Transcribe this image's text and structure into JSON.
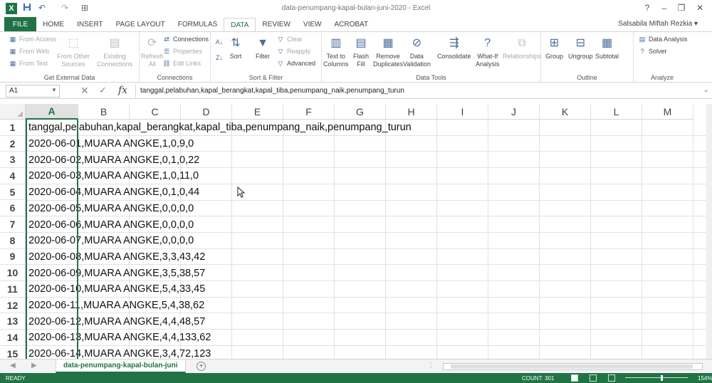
{
  "window": {
    "title": "data-penumpang-kapal-bulan-juni-2020 - Excel",
    "user": "Salsabila Miftah Rezkia",
    "help": "?",
    "minimize": "–",
    "maximize": "❐",
    "close": "✕"
  },
  "qat": {
    "logo": "X",
    "save": "💾",
    "undo": "↶",
    "redo": "↷",
    "customize": "⊞"
  },
  "tabs": [
    "FILE",
    "HOME",
    "INSERT",
    "PAGE LAYOUT",
    "FORMULAS",
    "DATA",
    "REVIEW",
    "VIEW",
    "ACROBAT"
  ],
  "active_tab": "DATA",
  "ribbon": {
    "get_external": {
      "label": "Get External Data",
      "from_access": "From Access",
      "from_web": "From Web",
      "from_text": "From Text",
      "from_other_1": "From Other",
      "from_other_2": "Sources",
      "existing_1": "Existing",
      "existing_2": "Connections"
    },
    "connections": {
      "label": "Connections",
      "refresh_1": "Refresh",
      "refresh_2": "All",
      "connections": "Connections",
      "properties": "Properties",
      "edit_links": "Edit Links"
    },
    "sort_filter": {
      "label": "Sort & Filter",
      "sort": "Sort",
      "filter": "Filter",
      "clear": "Clear",
      "reapply": "Reapply",
      "advanced": "Advanced"
    },
    "data_tools": {
      "label": "Data Tools",
      "text_to_columns_1": "Text to",
      "text_to_columns_2": "Columns",
      "flash_fill_1": "Flash",
      "flash_fill_2": "Fill",
      "remove_dup_1": "Remove",
      "remove_dup_2": "Duplicates",
      "validation_1": "Data",
      "validation_2": "Validation",
      "consolidate": "Consolidate",
      "whatif_1": "What-If",
      "whatif_2": "Analysis",
      "relationships": "Relationships"
    },
    "outline": {
      "label": "Outline",
      "group": "Group",
      "ungroup": "Ungroup",
      "subtotal": "Subtotal"
    },
    "analyze": {
      "label": "Analyze",
      "data_analysis": "Data Analysis",
      "solver": "Solver"
    }
  },
  "formula_bar": {
    "name_box": "A1",
    "fx": "fx",
    "cancel": "✕",
    "enter": "✓",
    "content": "tanggal,pelabuhan,kapal_berangkat,kapal_tiba,penumpang_naik,penumpang_turun"
  },
  "columns": [
    "A",
    "B",
    "C",
    "D",
    "E",
    "F",
    "G",
    "H",
    "I",
    "J",
    "K",
    "L",
    "M"
  ],
  "rows": [
    {
      "num": "1",
      "text": "tanggal,pelabuhan,kapal_berangkat,kapal_tiba,penumpang_naik,penumpang_turun"
    },
    {
      "num": "2",
      "text": "2020-06-01,MUARA ANGKE,1,0,9,0"
    },
    {
      "num": "3",
      "text": "2020-06-02,MUARA ANGKE,0,1,0,22"
    },
    {
      "num": "4",
      "text": "2020-06-03,MUARA ANGKE,1,0,11,0"
    },
    {
      "num": "5",
      "text": "2020-06-04,MUARA ANGKE,0,1,0,44"
    },
    {
      "num": "6",
      "text": "2020-06-05,MUARA ANGKE,0,0,0,0"
    },
    {
      "num": "7",
      "text": "2020-06-06,MUARA ANGKE,0,0,0,0"
    },
    {
      "num": "8",
      "text": "2020-06-07,MUARA ANGKE,0,0,0,0"
    },
    {
      "num": "9",
      "text": "2020-06-08,MUARA ANGKE,3,3,43,42"
    },
    {
      "num": "10",
      "text": "2020-06-09,MUARA ANGKE,3,5,38,57"
    },
    {
      "num": "11",
      "text": "2020-06-10,MUARA ANGKE,5,4,33,45"
    },
    {
      "num": "12",
      "text": "2020-06-11,MUARA ANGKE,5,4,38,62"
    },
    {
      "num": "13",
      "text": "2020-06-12,MUARA ANGKE,4,4,48,57"
    },
    {
      "num": "14",
      "text": "2020-06-13,MUARA ANGKE,4,4,133,62"
    },
    {
      "num": "15",
      "text": "2020-06-14,MUARA ANGKE,3,4,72,123"
    }
  ],
  "sheet": {
    "name": "data-penumpang-kapal-bulan-juni",
    "add": "+"
  },
  "status": {
    "ready": "READY",
    "count": "COUNT: 301",
    "zoom": "154%"
  }
}
